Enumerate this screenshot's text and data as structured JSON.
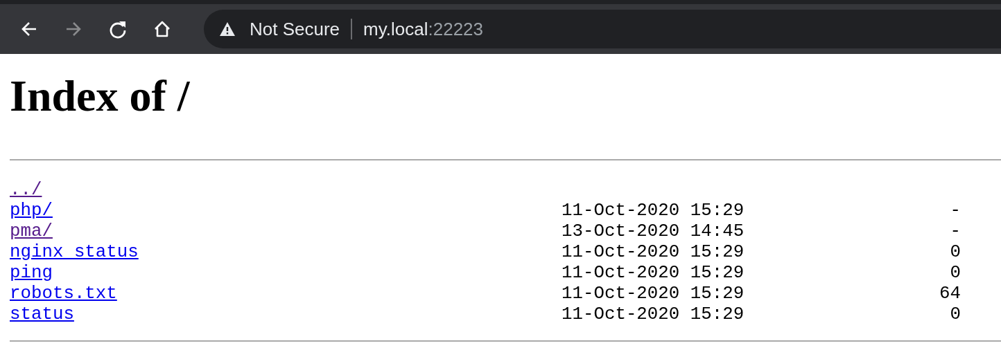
{
  "browser": {
    "back_disabled": false,
    "forward_disabled": true,
    "security": "Not Secure",
    "url_host": "my.local",
    "url_port": ":22223"
  },
  "page": {
    "title": "Index of /",
    "entries": [
      {
        "name": "../",
        "visited": true
      },
      {
        "name": "php/",
        "visited": false,
        "date": "11-Oct-2020 15:29",
        "size": "-"
      },
      {
        "name": "pma/",
        "visited": true,
        "date": "13-Oct-2020 14:45",
        "size": "-"
      },
      {
        "name": "nginx_status",
        "visited": false,
        "date": "11-Oct-2020 15:29",
        "size": "0"
      },
      {
        "name": "ping",
        "visited": false,
        "date": "11-Oct-2020 15:29",
        "size": "0"
      },
      {
        "name": "robots.txt",
        "visited": false,
        "date": "11-Oct-2020 15:29",
        "size": "64"
      },
      {
        "name": "status",
        "visited": false,
        "date": "11-Oct-2020 15:29",
        "size": "0"
      }
    ]
  }
}
